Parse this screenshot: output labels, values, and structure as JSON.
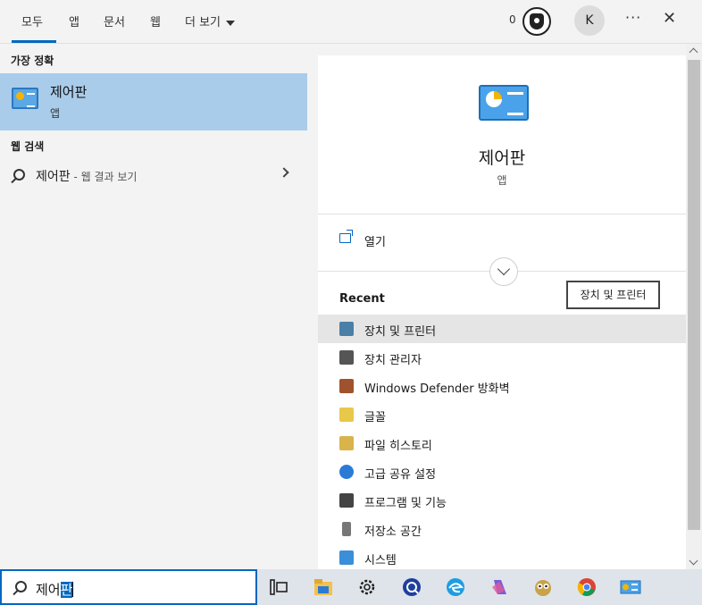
{
  "tabs": [
    {
      "label": "모두",
      "active": true
    },
    {
      "label": "앱"
    },
    {
      "label": "문서"
    },
    {
      "label": "웹"
    },
    {
      "label": "더 보기"
    }
  ],
  "header": {
    "points": "0",
    "avatar_letter": "K"
  },
  "left": {
    "best_match_title": "가장 정확",
    "best": {
      "name": "제어판",
      "type": "앱"
    },
    "web_title": "웹 검색",
    "web": {
      "query": "제어판",
      "suffix": " - 웹 결과 보기"
    }
  },
  "right": {
    "app_name": "제어판",
    "app_type": "앱",
    "open_label": "열기",
    "recent_title": "Recent",
    "tooltip": "장치 및 프린터",
    "recent": [
      {
        "label": "장치 및 프린터",
        "icon": "printer-icon",
        "color": "#4a7fa8",
        "highlighted": true
      },
      {
        "label": "장치 관리자",
        "icon": "device-manager-icon",
        "color": "#555555"
      },
      {
        "label": "Windows Defender 방화벽",
        "icon": "firewall-icon",
        "color": "#a0522d"
      },
      {
        "label": "글꼴",
        "icon": "fonts-icon",
        "color": "#e8c84a"
      },
      {
        "label": "파일 히스토리",
        "icon": "file-history-icon",
        "color": "#d9b44a"
      },
      {
        "label": "고급 공유 설정",
        "icon": "sharing-icon",
        "color": "#2b7bd6"
      },
      {
        "label": "프로그램 및 기능",
        "icon": "programs-icon",
        "color": "#444444"
      },
      {
        "label": "저장소 공간",
        "icon": "storage-icon",
        "color": "#777777"
      },
      {
        "label": "시스템",
        "icon": "system-icon",
        "color": "#3b8ed8"
      }
    ]
  },
  "taskbar": {
    "search_text_plain": "제어",
    "search_text_selected": "판",
    "icons": [
      "task-view-icon",
      "file-explorer-icon",
      "settings-icon",
      "app-icon",
      "edge-icon",
      "copilot-icon",
      "owl-app-icon",
      "chrome-icon",
      "control-panel-icon"
    ]
  },
  "colors": {
    "accent": "#0067c0",
    "best_match_bg": "#a9ccea",
    "highlight_bg": "#e5e5e5"
  }
}
